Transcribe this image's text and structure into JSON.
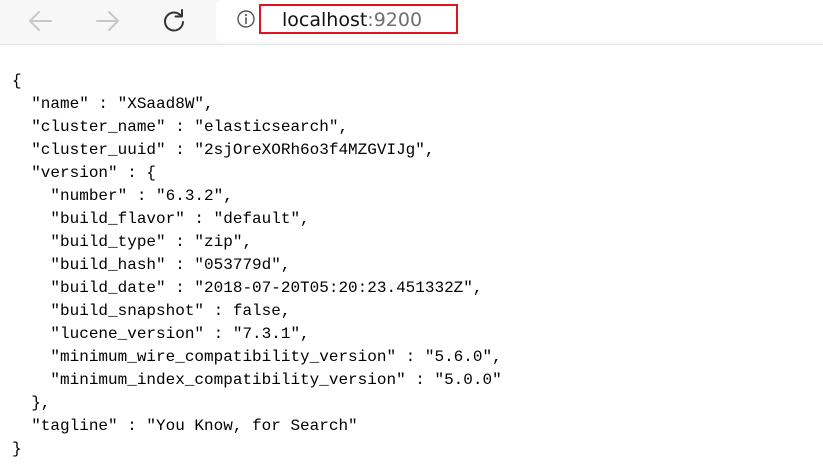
{
  "browser": {
    "back_icon": "arrow-left-icon",
    "forward_icon": "arrow-right-icon",
    "reload_icon": "reload-icon",
    "site_info_icon": "info-icon",
    "url_host": "localhost",
    "url_port": ":9200",
    "highlight_color": "#e0141e"
  },
  "json_lines": [
    "{",
    "  \"name\" : \"XSaad8W\",",
    "  \"cluster_name\" : \"elasticsearch\",",
    "  \"cluster_uuid\" : \"2sjOreXORh6o3f4MZGVIJg\",",
    "  \"version\" : {",
    "    \"number\" : \"6.3.2\",",
    "    \"build_flavor\" : \"default\",",
    "    \"build_type\" : \"zip\",",
    "    \"build_hash\" : \"053779d\",",
    "    \"build_date\" : \"2018-07-20T05:20:23.451332Z\",",
    "    \"build_snapshot\" : false,",
    "    \"lucene_version\" : \"7.3.1\",",
    "    \"minimum_wire_compatibility_version\" : \"5.6.0\",",
    "    \"minimum_index_compatibility_version\" : \"5.0.0\"",
    "  },",
    "  \"tagline\" : \"You Know, for Search\"",
    "}"
  ]
}
